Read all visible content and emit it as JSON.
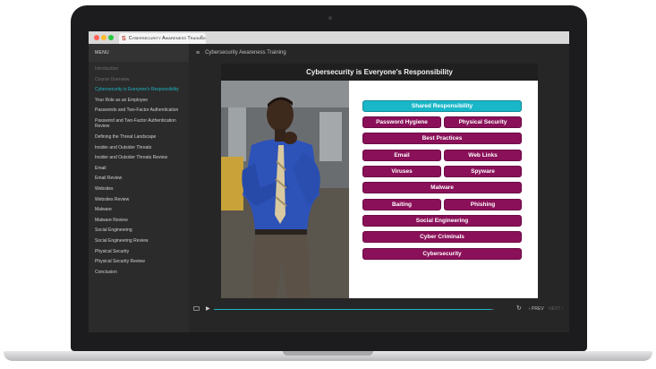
{
  "browser": {
    "tab_title": "Cybersecurity Awareness Training",
    "tab_logo": "S",
    "tab_close": "×"
  },
  "sidebar": {
    "menu_label": "MENU",
    "items": [
      {
        "label": "Introduction",
        "state": "dim"
      },
      {
        "label": "Course Overview",
        "state": "dim"
      },
      {
        "label": "Cybersecurity is Everyone's Responsibility",
        "state": "active"
      },
      {
        "label": "Your Role as an Employee",
        "state": "normal"
      },
      {
        "label": "Passwords and Two-Factor Authentication",
        "state": "normal"
      },
      {
        "label": "Password and Two-Factor Authentication Review",
        "state": "normal"
      },
      {
        "label": "Defining the Threat Landscape",
        "state": "normal"
      },
      {
        "label": "Insider and Outsider Threats",
        "state": "normal"
      },
      {
        "label": "Insider and Outsider Threats Review",
        "state": "normal"
      },
      {
        "label": "Email",
        "state": "normal"
      },
      {
        "label": "Email Review",
        "state": "normal"
      },
      {
        "label": "Websites",
        "state": "normal"
      },
      {
        "label": "Websites Review",
        "state": "normal"
      },
      {
        "label": "Malware",
        "state": "normal"
      },
      {
        "label": "Malware Review",
        "state": "normal"
      },
      {
        "label": "Social Engineering",
        "state": "normal"
      },
      {
        "label": "Social Engineering Review",
        "state": "normal"
      },
      {
        "label": "Physical Security",
        "state": "normal"
      },
      {
        "label": "Physical Security Review",
        "state": "normal"
      },
      {
        "label": "Conclusion",
        "state": "normal"
      }
    ]
  },
  "main": {
    "course_title": "Cybersecurity Awareness Training",
    "menu_icon": "≡",
    "slide_title": "Cybersecurity is Everyone's Responsibility",
    "pills": [
      {
        "label": "Shared Responsibility",
        "color": "#19b7c8"
      },
      {
        "label": "Password Hygiene",
        "color": "#8a1059"
      },
      {
        "label": "Physical Security",
        "color": "#8a1059"
      },
      {
        "label": "Best Practices",
        "color": "#8a1059"
      },
      {
        "label": "Email",
        "color": "#8a1059"
      },
      {
        "label": "Web Links",
        "color": "#8a1059"
      },
      {
        "label": "Viruses",
        "color": "#8a1059"
      },
      {
        "label": "Spyware",
        "color": "#8a1059"
      },
      {
        "label": "Malware",
        "color": "#8a1059"
      },
      {
        "label": "Baiting",
        "color": "#8a1059"
      },
      {
        "label": "Phishing",
        "color": "#8a1059"
      },
      {
        "label": "Social Engineering",
        "color": "#8a1059"
      },
      {
        "label": "Cyber Criminals",
        "color": "#8a1059"
      },
      {
        "label": "Cybersecurity",
        "color": "#8a1059"
      }
    ]
  },
  "player": {
    "play_icon": "▶",
    "replay_icon": "↻",
    "prev_label": "‹ PREV",
    "next_label": "NEXT ›",
    "progress_fraction": 0.99,
    "accent_color": "#1fb5c4"
  }
}
